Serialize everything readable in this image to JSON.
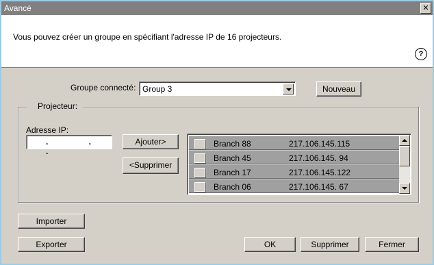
{
  "window": {
    "title": "Avancé",
    "close_glyph": "✕"
  },
  "description": "Vous pouvez créer un groupe en spécifiant l'adresse IP de 16 projecteurs.",
  "help_icon": {
    "glyph": "?"
  },
  "group": {
    "label": "Groupe connecté:",
    "selected": "Group 3",
    "new_button": "Nouveau"
  },
  "projector": {
    "section_label": "Projecteur:",
    "ip_label": "Adresse IP:",
    "ip_placeholder": ".   .   .",
    "add_button": "Ajouter>",
    "remove_button": "<Supprimer",
    "rows": [
      {
        "name": "Branch 88",
        "ip": "217.106.145.115"
      },
      {
        "name": "Branch 45",
        "ip": "217.106.145. 94"
      },
      {
        "name": "Branch 17",
        "ip": "217.106.145.122"
      },
      {
        "name": "Branch 06",
        "ip": "217.106.145. 67"
      }
    ]
  },
  "buttons": {
    "import": "Importer",
    "export": "Exporter",
    "ok": "OK",
    "delete": "Supprimer",
    "close": "Fermer"
  }
}
